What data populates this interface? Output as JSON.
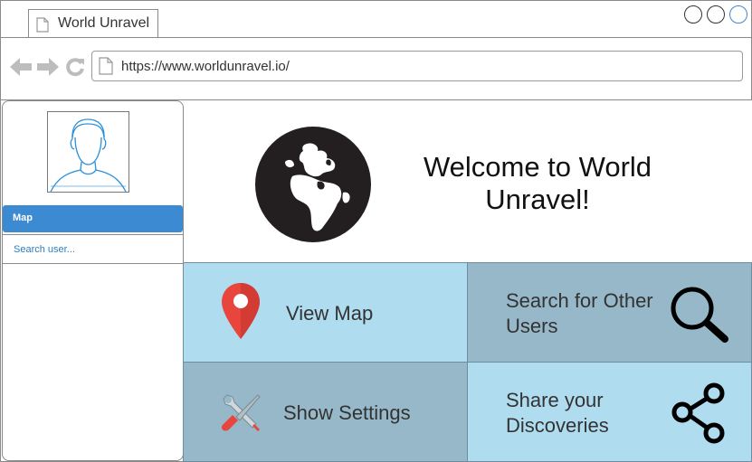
{
  "browser": {
    "tab_title": "World Unravel",
    "url": "https://www.worldunravel.io/"
  },
  "sidebar": {
    "items": [
      {
        "label": "Map",
        "active": true
      },
      {
        "label": "Search user...",
        "active": false
      }
    ]
  },
  "hero": {
    "welcome": "Welcome to World Unravel!"
  },
  "tiles": [
    {
      "label": "View Map",
      "icon": "map-pin-icon"
    },
    {
      "label": "Search for Other Users",
      "icon": "magnifier-icon"
    },
    {
      "label": "Show Settings",
      "icon": "tools-icon"
    },
    {
      "label": "Share your Discoveries",
      "icon": "share-icon"
    }
  ],
  "colors": {
    "accent": "#3b8ad2",
    "tile_light": "#b0dcf0",
    "tile_dark": "#96b8c9",
    "pin": "#e8453c"
  }
}
